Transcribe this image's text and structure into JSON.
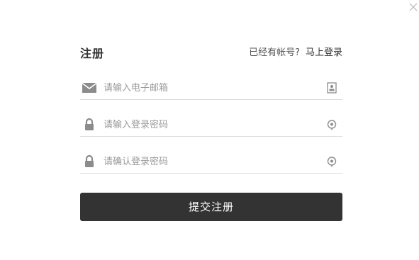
{
  "dialog": {
    "close_icon": "close-icon"
  },
  "form": {
    "title": "注册",
    "login_prompt": "已经有帐号?",
    "login_link": "马上登录",
    "fields": [
      {
        "icon": "envelope-icon",
        "placeholder": "请输入电子邮箱",
        "action_icon": "contact-card-icon"
      },
      {
        "icon": "lock-icon",
        "placeholder": "请输入登录密码",
        "action_icon": "eye-icon"
      },
      {
        "icon": "lock-icon",
        "placeholder": "请确认登录密码",
        "action_icon": "eye-icon"
      }
    ],
    "submit_label": "提交注册"
  },
  "colors": {
    "primary_button": "#333333",
    "icon_gray": "#8c8c8c",
    "placeholder": "#9a9a9a",
    "divider": "#dcdcdc"
  }
}
